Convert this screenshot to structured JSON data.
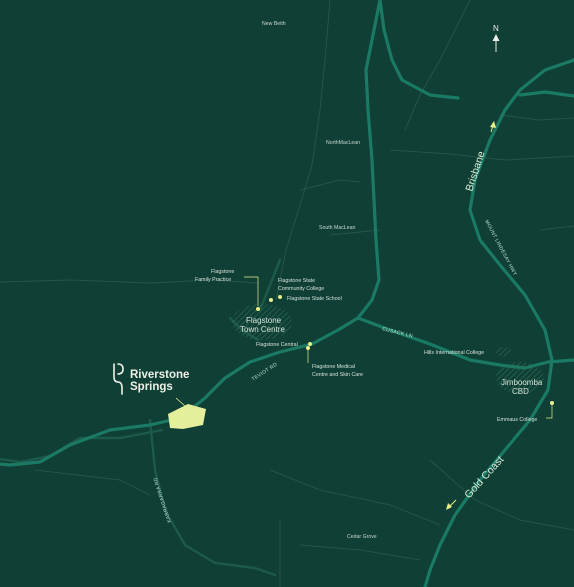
{
  "map": {
    "north_label": "N",
    "colors": {
      "background": "#0f3f35",
      "major_road": "#1b7a64",
      "minor_road": "#1d5a4b",
      "boundary": "#245648",
      "poi_marker": "#e9f08a",
      "site_fill": "#e3ef9a",
      "label": "#d7e3da"
    },
    "localities": [
      "New Beith",
      "NorthMacLean",
      "South MacLean",
      "Cedar Grove"
    ],
    "towns": {
      "flagstone_line1": "Flagstone",
      "flagstone_line2": "Town Centre",
      "jimboomba_line1": "Jimboomba",
      "jimboomba_line2": "CBD"
    },
    "roads": [
      "CUSACK LN",
      "TEVIOT RD",
      "MOUNT LINDESAY HWY",
      "KARRAGARRA RD"
    ],
    "destinations": {
      "north": "Brisbane",
      "south": "Gold Coast"
    },
    "pois": {
      "family_practice_line1": "Flagstone",
      "family_practice_line2": "Family Practice",
      "community_college_line1": "Flagstone State",
      "community_college_line2": "Community College",
      "state_school": "Flagstone State School",
      "central": "Flagstone Central",
      "medical_line1": "Flagstone Medical",
      "medical_line2": "Centre and Skin Care",
      "hills_college": "Hills International College",
      "emmaus_college": "Emmaus College"
    },
    "brand": {
      "line1": "Riverstone",
      "line2": "Springs"
    }
  }
}
